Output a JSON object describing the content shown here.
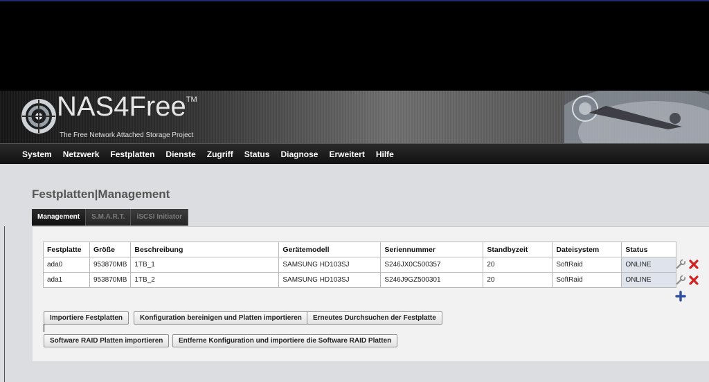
{
  "logo": {
    "name": "NAS4Free",
    "trademark": "TM",
    "tagline": "The Free Network Attached Storage Project"
  },
  "nav": {
    "items": [
      "System",
      "Netzwerk",
      "Festplatten",
      "Dienste",
      "Zugriff",
      "Status",
      "Diagnose",
      "Erweitert",
      "Hilfe"
    ]
  },
  "page": {
    "title": "Festplatten|Management"
  },
  "tabs": {
    "management": "Management",
    "smart": "S.M.A.R.T.",
    "iscsi": "iSCSI Initiator"
  },
  "table": {
    "headers": {
      "disk": "Festplatte",
      "size": "Größe",
      "description": "Beschreibung",
      "model": "Gerätemodell",
      "serial": "Seriennummer",
      "standby": "Standbyzeit",
      "filesystem": "Dateisystem",
      "status": "Status"
    },
    "rows": [
      {
        "disk": "ada0",
        "size": "953870MB",
        "description": "1TB_1",
        "model": "SAMSUNG HD103SJ",
        "serial": "S246JX0C500357",
        "standby": "20",
        "filesystem": "SoftRaid",
        "status": "ONLINE"
      },
      {
        "disk": "ada1",
        "size": "953870MB",
        "description": "1TB_2",
        "model": "SAMSUNG HD103SJ",
        "serial": "S246J9GZ500301",
        "standby": "20",
        "filesystem": "SoftRaid",
        "status": "ONLINE"
      }
    ]
  },
  "buttons": {
    "import": "Importiere Festplatten",
    "clear_import": "Konfiguration bereinigen und Platten importieren",
    "rescan": "Erneutes Durchsuchen der Festplatte",
    "import_raid": "Software RAID Platten importieren",
    "remove_import_raid": "Entferne Konfiguration und importiere die Software RAID Platten"
  },
  "icons": {
    "edit": "wrench-icon",
    "delete": "red-x-icon",
    "add": "blue-plus-icon"
  },
  "colors": {
    "nav_bg": "#1a1a1a",
    "content_bg": "#dcdde0",
    "panel_bg": "#f2f2f2",
    "status_cell": "#dfe3ec",
    "delete_red": "#d21f1f",
    "add_blue": "#2f4f9e"
  }
}
